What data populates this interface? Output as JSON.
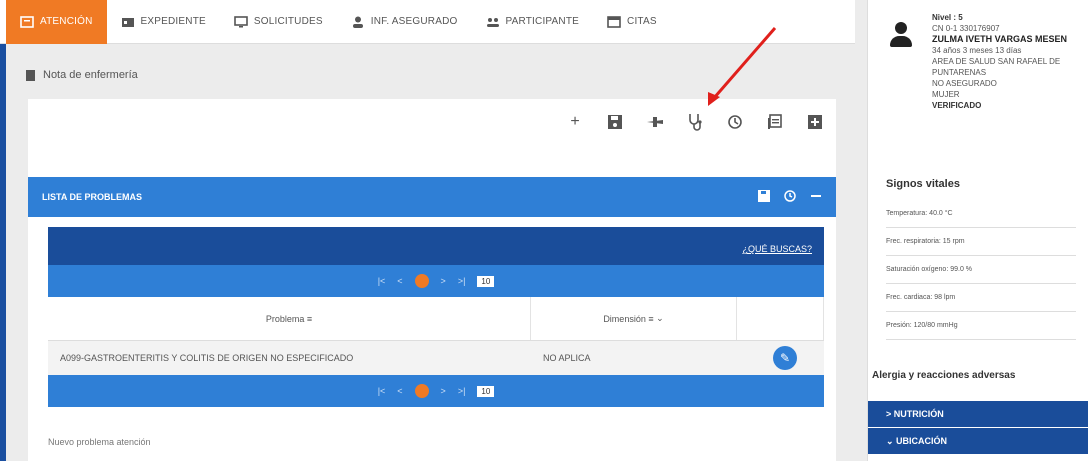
{
  "nav": {
    "tabs": [
      {
        "label": "ATENCIÓN",
        "icon": "clipboard-icon"
      },
      {
        "label": "EXPEDIENTE",
        "icon": "folder-icon"
      },
      {
        "label": "SOLICITUDES",
        "icon": "monitor-icon"
      },
      {
        "label": "INF. ASEGURADO",
        "icon": "person-icon"
      },
      {
        "label": "PARTICIPANTE",
        "icon": "group-icon"
      },
      {
        "label": "CITAS",
        "icon": "calendar-icon"
      }
    ]
  },
  "breadcrumb": "Nota de enfermería",
  "toolbar": {
    "icons": [
      "plus-icon",
      "save-icon",
      "plane-icon",
      "stethoscope-icon",
      "history-icon",
      "list-icon",
      "add-box-icon"
    ]
  },
  "problems": {
    "title": "LISTA DE PROBLEMAS",
    "search_link": "¿QUÉ BUSCAS?",
    "page_current": "1",
    "page_size": "10",
    "columns": [
      "Problema",
      "Dimensión"
    ],
    "rows": [
      {
        "problema": "A099-GASTROENTERITIS Y COLITIS DE ORIGEN NO ESPECIFICADO",
        "dimension": "NO APLICA"
      }
    ],
    "new_problem": "Nuevo problema atención"
  },
  "patient": {
    "level": "Nivel : 5",
    "id": "CN 0-1 330176907",
    "name": "ZULMA IVETH VARGAS MESEN",
    "age": "34 años 3 meses 13 días",
    "area": "AREA DE SALUD SAN RAFAEL DE PUNTARENAS",
    "insured": "NO ASEGURADO",
    "gender": "MUJER",
    "status": "VERIFICADO"
  },
  "vitals": {
    "title": "Signos vitales",
    "items": [
      "Temperatura: 40.0 °C",
      "Frec. respiratoria: 15 rpm",
      "Saturación oxígeno: 99.0 %",
      "Frec. cardiaca: 98 lpm",
      "Presión: 120/80 mmHg"
    ]
  },
  "allergies_title": "Alergia y reacciones adversas",
  "accordions": [
    "> NUTRICIÓN",
    "⌄ UBICACIÓN"
  ],
  "colors": {
    "accent": "#f07a24",
    "primary": "#2f7fd6",
    "dark": "#1a4d9a"
  }
}
